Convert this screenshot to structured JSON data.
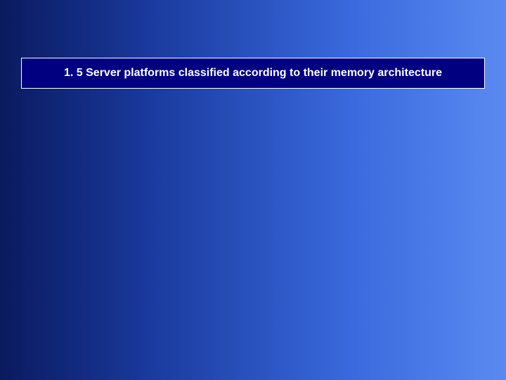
{
  "slide": {
    "title": "1. 5 Server platforms classified according to their memory architecture"
  }
}
